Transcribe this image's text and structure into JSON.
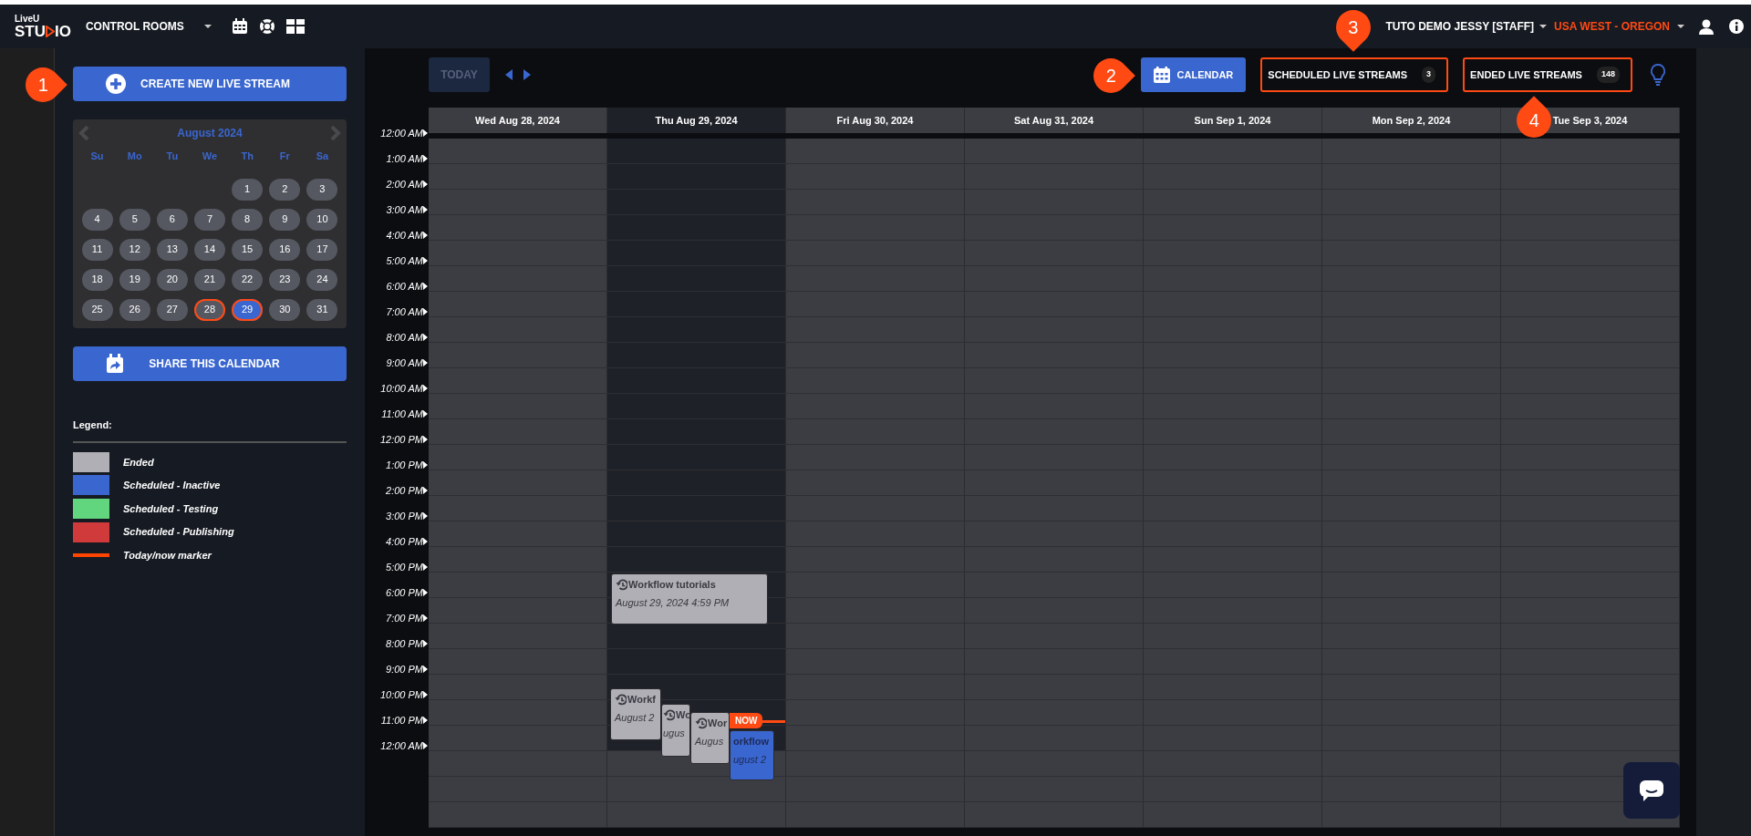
{
  "navbar": {
    "logo": {
      "top": "LiveU",
      "left": "STU",
      "right": "IO"
    },
    "menu": "CONTROL ROOMS",
    "user": "TUTO DEMO JESSY [STAFF]",
    "region": "USA WEST - OREGON"
  },
  "sidebar": {
    "create_button": {
      "label": "CREATE NEW LIVE STREAM",
      "callout": "1"
    },
    "mini_calendar": {
      "title": "August 2024",
      "weekdays": [
        "Su",
        "Mo",
        "Tu",
        "We",
        "Th",
        "Fr",
        "Sa"
      ],
      "weeks": [
        [
          {
            "kind": "blank"
          },
          {
            "kind": "blank"
          },
          {
            "kind": "blank"
          },
          {
            "kind": "blank"
          },
          {
            "kind": "day",
            "label": "1",
            "selected": false,
            "outlined": false
          },
          {
            "kind": "day",
            "label": "2",
            "selected": false,
            "outlined": false
          },
          {
            "kind": "day",
            "label": "3",
            "selected": false,
            "outlined": false
          }
        ],
        [
          {
            "kind": "day",
            "label": "4",
            "selected": false,
            "outlined": false
          },
          {
            "kind": "day",
            "label": "5",
            "selected": false,
            "outlined": false
          },
          {
            "kind": "day",
            "label": "6",
            "selected": false,
            "outlined": false
          },
          {
            "kind": "day",
            "label": "7",
            "selected": false,
            "outlined": false
          },
          {
            "kind": "day",
            "label": "8",
            "selected": false,
            "outlined": false
          },
          {
            "kind": "day",
            "label": "9",
            "selected": false,
            "outlined": false
          },
          {
            "kind": "day",
            "label": "10",
            "selected": false,
            "outlined": false
          }
        ],
        [
          {
            "kind": "day",
            "label": "11",
            "selected": false,
            "outlined": false
          },
          {
            "kind": "day",
            "label": "12",
            "selected": false,
            "outlined": false
          },
          {
            "kind": "day",
            "label": "13",
            "selected": false,
            "outlined": false
          },
          {
            "kind": "day",
            "label": "14",
            "selected": false,
            "outlined": false
          },
          {
            "kind": "day",
            "label": "15",
            "selected": false,
            "outlined": false
          },
          {
            "kind": "day",
            "label": "16",
            "selected": false,
            "outlined": false
          },
          {
            "kind": "day",
            "label": "17",
            "selected": false,
            "outlined": false
          }
        ],
        [
          {
            "kind": "day",
            "label": "18",
            "selected": false,
            "outlined": false
          },
          {
            "kind": "day",
            "label": "19",
            "selected": false,
            "outlined": false
          },
          {
            "kind": "day",
            "label": "20",
            "selected": false,
            "outlined": false
          },
          {
            "kind": "day",
            "label": "21",
            "selected": false,
            "outlined": false
          },
          {
            "kind": "day",
            "label": "22",
            "selected": false,
            "outlined": false
          },
          {
            "kind": "day",
            "label": "23",
            "selected": false,
            "outlined": false
          },
          {
            "kind": "day",
            "label": "24",
            "selected": false,
            "outlined": false
          }
        ],
        [
          {
            "kind": "day",
            "label": "25",
            "selected": false,
            "outlined": false
          },
          {
            "kind": "day",
            "label": "26",
            "selected": false,
            "outlined": false
          },
          {
            "kind": "day",
            "label": "27",
            "selected": false,
            "outlined": false
          },
          {
            "kind": "day",
            "label": "28",
            "selected": false,
            "outlined": true
          },
          {
            "kind": "day",
            "label": "29",
            "selected": true,
            "outlined": true
          },
          {
            "kind": "day",
            "label": "30",
            "selected": false,
            "outlined": false
          },
          {
            "kind": "day",
            "label": "31",
            "selected": false,
            "outlined": false
          }
        ]
      ]
    },
    "share_button": {
      "label": "SHARE THIS CALENDAR"
    },
    "legend": {
      "title": "Legend:",
      "items": [
        {
          "label": "Ended",
          "kind": "swatch",
          "color": "#b0afb5"
        },
        {
          "label": "Scheduled - Inactive",
          "kind": "swatch",
          "color": "#3a66cf"
        },
        {
          "label": "Scheduled - Testing",
          "kind": "swatch",
          "color": "#62d67f"
        },
        {
          "label": "Scheduled - Publishing",
          "kind": "swatch",
          "color": "#d13a3a"
        },
        {
          "label": "Today/now marker",
          "kind": "line",
          "color": "#ff4500"
        }
      ]
    }
  },
  "toolbar": {
    "today": {
      "label": "TODAY",
      "disabled": true
    },
    "views": [
      {
        "label": "CALENDAR",
        "kind": "calendar",
        "selected": true,
        "highlighted": false,
        "callout": "2"
      },
      {
        "label": "SCHEDULED LIVE STREAMS",
        "kind": "list",
        "count": "3",
        "selected": false,
        "highlighted": true,
        "callout": "3"
      },
      {
        "label": "ENDED LIVE STREAMS",
        "kind": "list",
        "count": "148",
        "selected": false,
        "highlighted": true,
        "callout": "4"
      }
    ]
  },
  "calendar": {
    "days": [
      {
        "label": "Wed Aug 28, 2024",
        "today": false
      },
      {
        "label": "Thu Aug 29, 2024",
        "today": true
      },
      {
        "label": "Fri Aug 30, 2024",
        "today": false
      },
      {
        "label": "Sat Aug 31, 2024",
        "today": false
      },
      {
        "label": "Sun Sep 1, 2024",
        "today": false
      },
      {
        "label": "Mon Sep 2, 2024",
        "today": false
      },
      {
        "label": "Tue Sep 3, 2024",
        "today": false
      }
    ],
    "times": [
      "12:00 AM",
      "1:00 AM",
      "2:00 AM",
      "3:00 AM",
      "4:00 AM",
      "5:00 AM",
      "6:00 AM",
      "7:00 AM",
      "8:00 AM",
      "9:00 AM",
      "10:00 AM",
      "11:00 AM",
      "12:00 PM",
      "1:00 PM",
      "2:00 PM",
      "3:00 PM",
      "4:00 PM",
      "5:00 PM",
      "6:00 PM",
      "7:00 PM",
      "8:00 PM",
      "9:00 PM",
      "10:00 PM",
      "11:00 PM",
      "12:00 AM"
    ],
    "now_label": "NOW",
    "events": [
      {
        "title": "Workflow tutorials",
        "date": "August 29, 2024 4:59 PM",
        "kind": "ended"
      },
      {
        "title": "Workf",
        "date": "August 2",
        "kind": "ended"
      },
      {
        "title": "Wo",
        "date": "ugus",
        "kind": "ended"
      },
      {
        "title": "Wor",
        "date": "Augus",
        "kind": "ended"
      },
      {
        "title": "orkflow",
        "date": "ugust 2",
        "kind": "inactive"
      }
    ]
  }
}
